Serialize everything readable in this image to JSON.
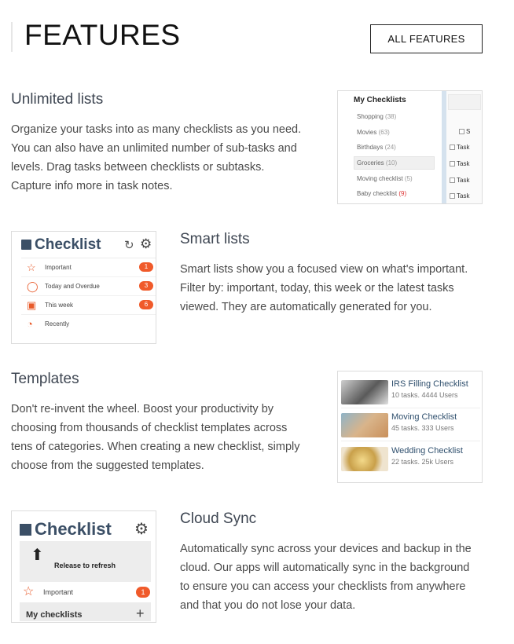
{
  "header": {
    "title": "FEATURES",
    "button_label": "ALL FEATURES"
  },
  "features": [
    {
      "title": "Unlimited lists",
      "lines": [
        "Organize your tasks into as many checklists as you need.",
        "You can also have an unlimited number of sub-tasks and",
        "levels. Drag tasks between checklists or subtasks.",
        "Capture info more in task notes."
      ]
    },
    {
      "title": "Smart lists",
      "lines": [
        "Smart lists show you a focused view on what's important.",
        "Filter by: important, today, this week or the latest tasks",
        "viewed. They are automatically generated for you."
      ]
    },
    {
      "title": "Templates",
      "lines": [
        "Don't re-invent the wheel. Boost your productivity by",
        "choosing from thousands of checklist templates across",
        "tens of categories. When creating a new checklist, simply",
        "choose from the suggested templates."
      ]
    },
    {
      "title": "Cloud Sync",
      "lines": [
        "Automatically sync across your devices and backup in the",
        "cloud. Our apps will automatically sync in the background",
        "to ensure you can access your checklists from anywhere",
        "and that you do not lose your data."
      ]
    }
  ],
  "shot1": {
    "heading": "My Checklists",
    "items": [
      {
        "name": "Shopping",
        "count": "(38)"
      },
      {
        "name": "Movies",
        "count": "(63)"
      },
      {
        "name": "Birthdays",
        "count": "(24)"
      },
      {
        "name": "Groceries",
        "count": "(10)"
      },
      {
        "name": "Moving checklist",
        "count": "(5)"
      },
      {
        "name": "Baby checklist",
        "count": "(9)"
      }
    ],
    "tasks": [
      "S",
      "Task",
      "Task",
      "Task",
      "Task"
    ]
  },
  "shot2": {
    "title": "Checklist",
    "rows": [
      {
        "label": "Important",
        "badge": "1",
        "icon": "star-icon"
      },
      {
        "label": "Today and Overdue",
        "badge": "3",
        "icon": "clock-icon"
      },
      {
        "label": "This week",
        "badge": "6",
        "icon": "calendar-icon"
      },
      {
        "label": "Recently",
        "badge": "",
        "icon": "history-icon"
      }
    ]
  },
  "shot3": {
    "templates": [
      {
        "name": "IRS Filling Checklist",
        "meta": "10 tasks. 4444 Users"
      },
      {
        "name": "Moving Checklist",
        "meta": "45 tasks. 333 Users"
      },
      {
        "name": "Wedding Checklist",
        "meta": "22 tasks. 25k Users"
      }
    ]
  },
  "shot4": {
    "title": "Checklist",
    "pull_text": "Release to refresh",
    "row_label": "Important",
    "row_badge": "1",
    "my_label": "My checklists"
  },
  "colors": {
    "accent": "#f05a2a",
    "brand": "#3b4f66",
    "title": "#3f4753"
  }
}
